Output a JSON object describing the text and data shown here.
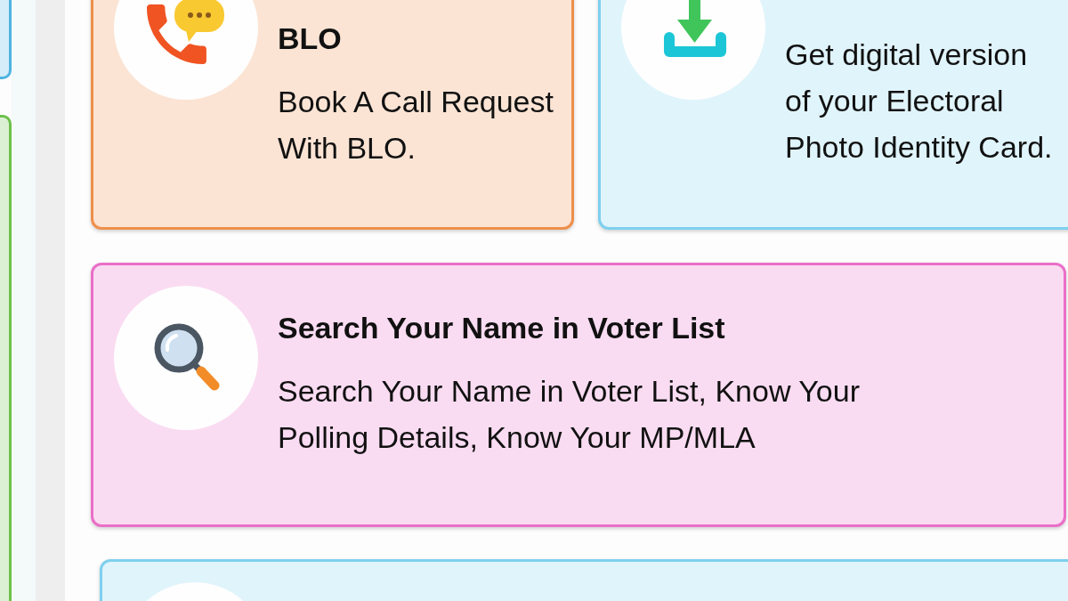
{
  "left_column": [
    {
      "color": "#4fb3e0"
    },
    {
      "color": "#6cc04a"
    }
  ],
  "cards": [
    {
      "kind": "call",
      "color": "#ee8f4b",
      "title": "BLO",
      "description": "Book A Call Request With BLO."
    },
    {
      "kind": "download",
      "color": "#7fd0ee",
      "description": "Get digital version of your Electoral Photo Identity Card."
    },
    {
      "kind": "search",
      "color": "#ea6fc8",
      "title": "Search Your Name in Voter List",
      "description": "Search Your Name in Voter List, Know Your Polling Details, Know Your MP/MLA"
    },
    {
      "color": "#7fd0ee"
    }
  ]
}
